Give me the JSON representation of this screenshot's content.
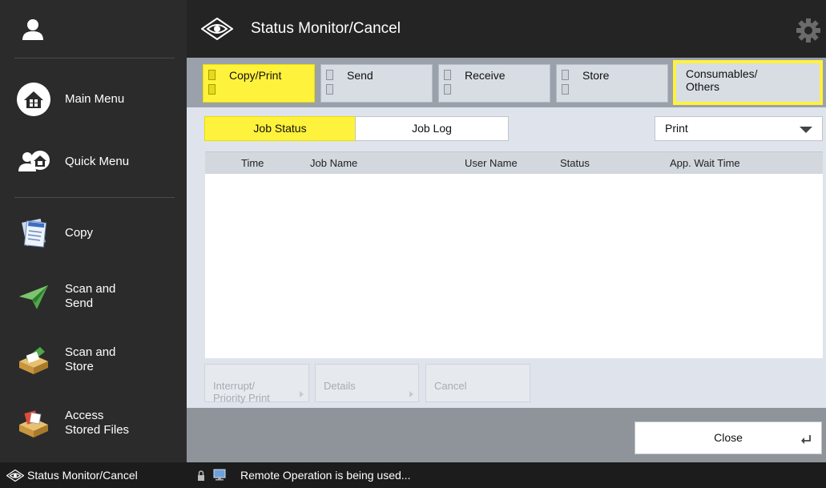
{
  "sidebar": {
    "user_icon": "user-icon",
    "items": [
      {
        "label": "Main Menu",
        "icon": "home-icon"
      },
      {
        "label": "Quick Menu",
        "icon": "quick-menu-icon"
      },
      {
        "label": "Copy",
        "icon": "copy-icon"
      },
      {
        "label": "Scan and\nSend",
        "icon": "scan-send-icon"
      },
      {
        "label": "Scan and\nStore",
        "icon": "scan-store-icon"
      },
      {
        "label": "Access\nStored Files",
        "icon": "stored-files-icon"
      }
    ]
  },
  "header": {
    "title": "Status Monitor/Cancel",
    "icon": "eye-icon",
    "settings_icon": "gear-icon"
  },
  "category_tabs": [
    {
      "label": "Copy/Print",
      "active": true
    },
    {
      "label": "Send",
      "active": false
    },
    {
      "label": "Receive",
      "active": false
    },
    {
      "label": "Store",
      "active": false
    },
    {
      "label": "Consumables/\nOthers",
      "active": false,
      "highlighted": true
    }
  ],
  "view_tabs": [
    {
      "label": "Job Status",
      "active": true
    },
    {
      "label": "Job Log",
      "active": false
    }
  ],
  "filter_dropdown": {
    "selected": "Print"
  },
  "table": {
    "columns": [
      "Time",
      "Job Name",
      "User Name",
      "Status",
      "App. Wait Time"
    ],
    "rows": []
  },
  "actions": [
    {
      "label": "Interrupt/\nPriority Print",
      "enabled": false
    },
    {
      "label": "Details",
      "enabled": false
    },
    {
      "label": "Cancel",
      "enabled": false
    }
  ],
  "close_button": {
    "label": "Close"
  },
  "status_bar": {
    "title": "Status Monitor/Cancel",
    "message": "Remote Operation is being used..."
  },
  "colors": {
    "accent_yellow": "#fff23c",
    "sidebar_bg": "#2b2b2b",
    "title_bg": "#242424",
    "panel_bg": "#dfe4ec"
  }
}
